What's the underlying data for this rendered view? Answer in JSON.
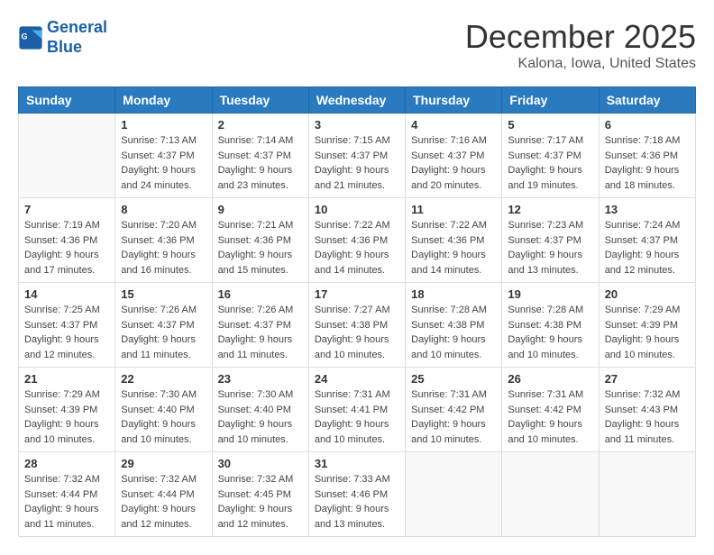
{
  "header": {
    "logo_line1": "General",
    "logo_line2": "Blue",
    "month": "December 2025",
    "location": "Kalona, Iowa, United States"
  },
  "weekdays": [
    "Sunday",
    "Monday",
    "Tuesday",
    "Wednesday",
    "Thursday",
    "Friday",
    "Saturday"
  ],
  "weeks": [
    [
      {
        "day": "",
        "empty": true
      },
      {
        "day": "1",
        "sunrise": "7:13 AM",
        "sunset": "4:37 PM",
        "daylight": "9 hours and 24 minutes."
      },
      {
        "day": "2",
        "sunrise": "7:14 AM",
        "sunset": "4:37 PM",
        "daylight": "9 hours and 23 minutes."
      },
      {
        "day": "3",
        "sunrise": "7:15 AM",
        "sunset": "4:37 PM",
        "daylight": "9 hours and 21 minutes."
      },
      {
        "day": "4",
        "sunrise": "7:16 AM",
        "sunset": "4:37 PM",
        "daylight": "9 hours and 20 minutes."
      },
      {
        "day": "5",
        "sunrise": "7:17 AM",
        "sunset": "4:37 PM",
        "daylight": "9 hours and 19 minutes."
      },
      {
        "day": "6",
        "sunrise": "7:18 AM",
        "sunset": "4:36 PM",
        "daylight": "9 hours and 18 minutes."
      }
    ],
    [
      {
        "day": "7",
        "sunrise": "7:19 AM",
        "sunset": "4:36 PM",
        "daylight": "9 hours and 17 minutes."
      },
      {
        "day": "8",
        "sunrise": "7:20 AM",
        "sunset": "4:36 PM",
        "daylight": "9 hours and 16 minutes."
      },
      {
        "day": "9",
        "sunrise": "7:21 AM",
        "sunset": "4:36 PM",
        "daylight": "9 hours and 15 minutes."
      },
      {
        "day": "10",
        "sunrise": "7:22 AM",
        "sunset": "4:36 PM",
        "daylight": "9 hours and 14 minutes."
      },
      {
        "day": "11",
        "sunrise": "7:22 AM",
        "sunset": "4:36 PM",
        "daylight": "9 hours and 14 minutes."
      },
      {
        "day": "12",
        "sunrise": "7:23 AM",
        "sunset": "4:37 PM",
        "daylight": "9 hours and 13 minutes."
      },
      {
        "day": "13",
        "sunrise": "7:24 AM",
        "sunset": "4:37 PM",
        "daylight": "9 hours and 12 minutes."
      }
    ],
    [
      {
        "day": "14",
        "sunrise": "7:25 AM",
        "sunset": "4:37 PM",
        "daylight": "9 hours and 12 minutes."
      },
      {
        "day": "15",
        "sunrise": "7:26 AM",
        "sunset": "4:37 PM",
        "daylight": "9 hours and 11 minutes."
      },
      {
        "day": "16",
        "sunrise": "7:26 AM",
        "sunset": "4:37 PM",
        "daylight": "9 hours and 11 minutes."
      },
      {
        "day": "17",
        "sunrise": "7:27 AM",
        "sunset": "4:38 PM",
        "daylight": "9 hours and 10 minutes."
      },
      {
        "day": "18",
        "sunrise": "7:28 AM",
        "sunset": "4:38 PM",
        "daylight": "9 hours and 10 minutes."
      },
      {
        "day": "19",
        "sunrise": "7:28 AM",
        "sunset": "4:38 PM",
        "daylight": "9 hours and 10 minutes."
      },
      {
        "day": "20",
        "sunrise": "7:29 AM",
        "sunset": "4:39 PM",
        "daylight": "9 hours and 10 minutes."
      }
    ],
    [
      {
        "day": "21",
        "sunrise": "7:29 AM",
        "sunset": "4:39 PM",
        "daylight": "9 hours and 10 minutes."
      },
      {
        "day": "22",
        "sunrise": "7:30 AM",
        "sunset": "4:40 PM",
        "daylight": "9 hours and 10 minutes."
      },
      {
        "day": "23",
        "sunrise": "7:30 AM",
        "sunset": "4:40 PM",
        "daylight": "9 hours and 10 minutes."
      },
      {
        "day": "24",
        "sunrise": "7:31 AM",
        "sunset": "4:41 PM",
        "daylight": "9 hours and 10 minutes."
      },
      {
        "day": "25",
        "sunrise": "7:31 AM",
        "sunset": "4:42 PM",
        "daylight": "9 hours and 10 minutes."
      },
      {
        "day": "26",
        "sunrise": "7:31 AM",
        "sunset": "4:42 PM",
        "daylight": "9 hours and 10 minutes."
      },
      {
        "day": "27",
        "sunrise": "7:32 AM",
        "sunset": "4:43 PM",
        "daylight": "9 hours and 11 minutes."
      }
    ],
    [
      {
        "day": "28",
        "sunrise": "7:32 AM",
        "sunset": "4:44 PM",
        "daylight": "9 hours and 11 minutes."
      },
      {
        "day": "29",
        "sunrise": "7:32 AM",
        "sunset": "4:44 PM",
        "daylight": "9 hours and 12 minutes."
      },
      {
        "day": "30",
        "sunrise": "7:32 AM",
        "sunset": "4:45 PM",
        "daylight": "9 hours and 12 minutes."
      },
      {
        "day": "31",
        "sunrise": "7:33 AM",
        "sunset": "4:46 PM",
        "daylight": "9 hours and 13 minutes."
      },
      {
        "day": "",
        "empty": true
      },
      {
        "day": "",
        "empty": true
      },
      {
        "day": "",
        "empty": true
      }
    ]
  ]
}
